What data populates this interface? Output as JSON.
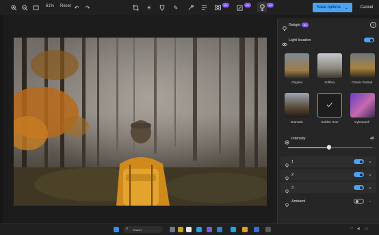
{
  "toolbar": {
    "zoom_level": "61%",
    "reset_label": "Reset",
    "save_label": "Save options",
    "cancel_label": "Cancel",
    "badge_ai": "AI"
  },
  "panel": {
    "relight_title": "Relight",
    "relight_badge": "AI",
    "light_location_label": "Light location",
    "presets": [
      {
        "label": "Original"
      },
      {
        "label": "Softbox"
      },
      {
        "label": "Classic Portrait"
      },
      {
        "label": "Dramatic"
      },
      {
        "label": "Golden Hour"
      },
      {
        "label": "Cyberpunk"
      }
    ],
    "intensity_label": "Intensity",
    "intensity_value": "48",
    "intensity_fraction": 0.48,
    "lights": [
      {
        "label": "1",
        "on": true
      },
      {
        "label": "2",
        "on": true
      },
      {
        "label": "3",
        "on": true
      }
    ],
    "ambient_label": "Ambient",
    "ambient_on": false
  },
  "taskbar": {
    "search_placeholder": "Search",
    "time": "",
    "date": ""
  },
  "colors": {
    "accent": "#4aa3f5",
    "ai_badge": "#8b5cf6",
    "panel_bg": "#262626"
  }
}
